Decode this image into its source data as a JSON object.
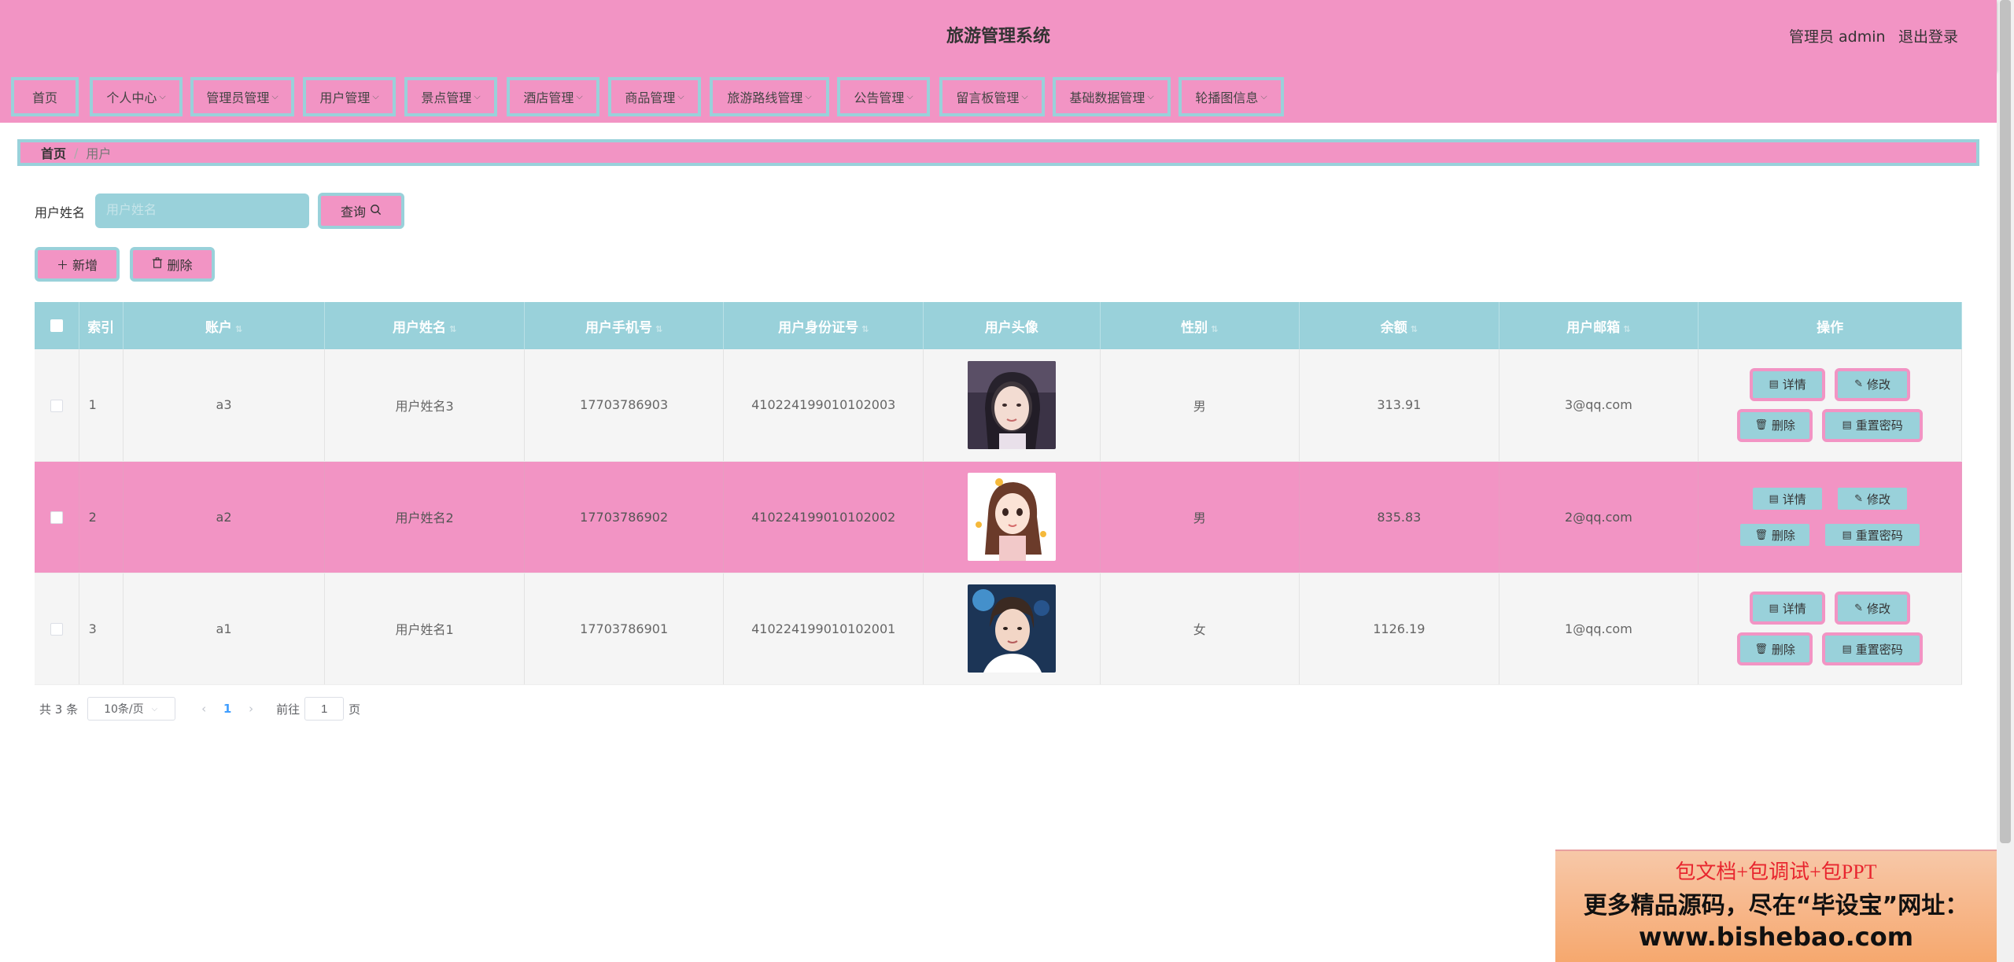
{
  "header": {
    "title": "旅游管理系统",
    "user": "管理员 admin",
    "logout": "退出登录"
  },
  "nav": {
    "items": [
      {
        "label": "首页",
        "has_dropdown": false
      },
      {
        "label": "个人中心",
        "has_dropdown": true
      },
      {
        "label": "管理员管理",
        "has_dropdown": true
      },
      {
        "label": "用户管理",
        "has_dropdown": true
      },
      {
        "label": "景点管理",
        "has_dropdown": true
      },
      {
        "label": "酒店管理",
        "has_dropdown": true
      },
      {
        "label": "商品管理",
        "has_dropdown": true
      },
      {
        "label": "旅游路线管理",
        "has_dropdown": true
      },
      {
        "label": "公告管理",
        "has_dropdown": true
      },
      {
        "label": "留言板管理",
        "has_dropdown": true
      },
      {
        "label": "基础数据管理",
        "has_dropdown": true
      },
      {
        "label": "轮播图信息",
        "has_dropdown": true
      }
    ]
  },
  "breadcrumb": {
    "home": "首页",
    "separator": "/",
    "current": "用户"
  },
  "search": {
    "label": "用户姓名",
    "placeholder": "用户姓名",
    "value": "",
    "query_button": "查询"
  },
  "actions": {
    "add": "新增",
    "delete": "删除"
  },
  "table": {
    "columns": [
      "索引",
      "账户",
      "用户姓名",
      "用户手机号",
      "用户身份证号",
      "用户头像",
      "性别",
      "余额",
      "用户邮箱",
      "操作"
    ],
    "rows": [
      {
        "index": "1",
        "account": "a3",
        "name": "用户姓名3",
        "phone": "17703786903",
        "id_card": "410224199010102003",
        "gender": "男",
        "balance": "313.91",
        "email": "3@qq.com"
      },
      {
        "index": "2",
        "account": "a2",
        "name": "用户姓名2",
        "phone": "17703786902",
        "id_card": "410224199010102002",
        "gender": "男",
        "balance": "835.83",
        "email": "2@qq.com"
      },
      {
        "index": "3",
        "account": "a1",
        "name": "用户姓名1",
        "phone": "17703786901",
        "id_card": "410224199010102001",
        "gender": "女",
        "balance": "1126.19",
        "email": "1@qq.com"
      }
    ],
    "row_actions": {
      "detail": "详情",
      "edit": "修改",
      "delete": "删除",
      "reset_password": "重置密码"
    }
  },
  "pagination": {
    "total": "共 3 条",
    "page_size": "10条/页",
    "current_page": "1",
    "goto_label": "前往",
    "goto_value": "1",
    "page_suffix": "页"
  },
  "ad": {
    "line1": "包文档+包调试+包PPT",
    "line2": "更多精品源码，尽在“毕设宝”网址：",
    "line3": "www.bishebao.com"
  },
  "colors": {
    "pink": "#f294c4",
    "teal": "#99d1da",
    "page_active": "#409eff"
  }
}
